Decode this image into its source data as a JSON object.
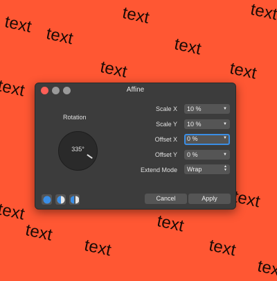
{
  "background": {
    "color": "#ff5733",
    "word": "text"
  },
  "dialog": {
    "title": "Affine",
    "rotation": {
      "label": "Rotation",
      "value": "335°"
    },
    "fields": {
      "scale_x": {
        "label": "Scale X",
        "value": "10 %"
      },
      "scale_y": {
        "label": "Scale Y",
        "value": "10 %"
      },
      "offset_x": {
        "label": "Offset X",
        "value": "0 %"
      },
      "offset_y": {
        "label": "Offset Y",
        "value": "0 %"
      },
      "extend_mode": {
        "label": "Extend Mode",
        "value": "Wrap"
      }
    },
    "buttons": {
      "cancel": "Cancel",
      "apply": "Apply"
    },
    "icons": {
      "dropdown": "▼",
      "stepper_up": "▲",
      "stepper_down": "▼"
    },
    "colors": {
      "accent": "#3a8ee6",
      "close": "#ff5f57"
    }
  }
}
